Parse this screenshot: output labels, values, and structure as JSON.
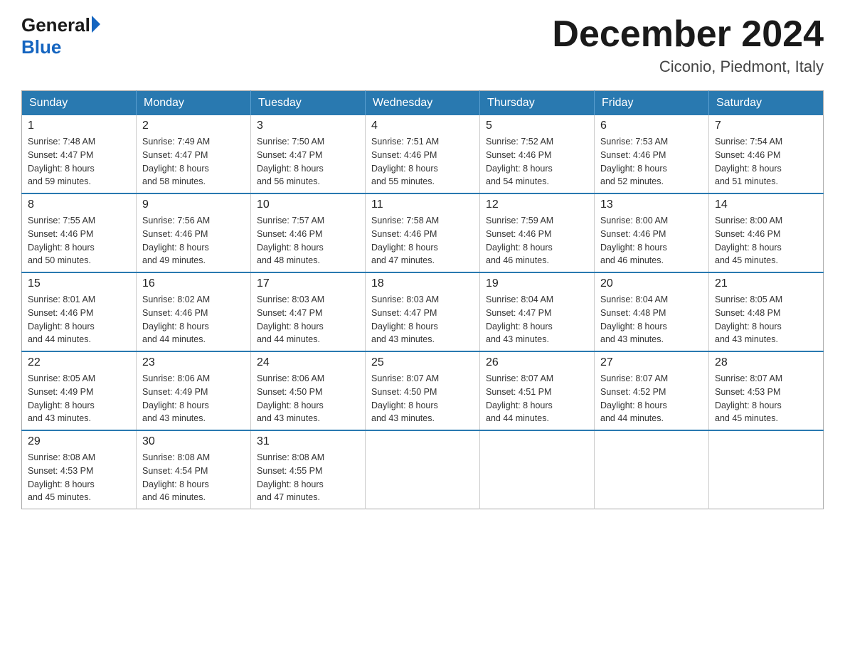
{
  "header": {
    "logo_general": "General",
    "logo_blue": "Blue",
    "month_title": "December 2024",
    "location": "Ciconio, Piedmont, Italy"
  },
  "days_of_week": [
    "Sunday",
    "Monday",
    "Tuesday",
    "Wednesday",
    "Thursday",
    "Friday",
    "Saturday"
  ],
  "weeks": [
    [
      {
        "day": "1",
        "sunrise": "7:48 AM",
        "sunset": "4:47 PM",
        "daylight": "8 hours and 59 minutes."
      },
      {
        "day": "2",
        "sunrise": "7:49 AM",
        "sunset": "4:47 PM",
        "daylight": "8 hours and 58 minutes."
      },
      {
        "day": "3",
        "sunrise": "7:50 AM",
        "sunset": "4:47 PM",
        "daylight": "8 hours and 56 minutes."
      },
      {
        "day": "4",
        "sunrise": "7:51 AM",
        "sunset": "4:46 PM",
        "daylight": "8 hours and 55 minutes."
      },
      {
        "day": "5",
        "sunrise": "7:52 AM",
        "sunset": "4:46 PM",
        "daylight": "8 hours and 54 minutes."
      },
      {
        "day": "6",
        "sunrise": "7:53 AM",
        "sunset": "4:46 PM",
        "daylight": "8 hours and 52 minutes."
      },
      {
        "day": "7",
        "sunrise": "7:54 AM",
        "sunset": "4:46 PM",
        "daylight": "8 hours and 51 minutes."
      }
    ],
    [
      {
        "day": "8",
        "sunrise": "7:55 AM",
        "sunset": "4:46 PM",
        "daylight": "8 hours and 50 minutes."
      },
      {
        "day": "9",
        "sunrise": "7:56 AM",
        "sunset": "4:46 PM",
        "daylight": "8 hours and 49 minutes."
      },
      {
        "day": "10",
        "sunrise": "7:57 AM",
        "sunset": "4:46 PM",
        "daylight": "8 hours and 48 minutes."
      },
      {
        "day": "11",
        "sunrise": "7:58 AM",
        "sunset": "4:46 PM",
        "daylight": "8 hours and 47 minutes."
      },
      {
        "day": "12",
        "sunrise": "7:59 AM",
        "sunset": "4:46 PM",
        "daylight": "8 hours and 46 minutes."
      },
      {
        "day": "13",
        "sunrise": "8:00 AM",
        "sunset": "4:46 PM",
        "daylight": "8 hours and 46 minutes."
      },
      {
        "day": "14",
        "sunrise": "8:00 AM",
        "sunset": "4:46 PM",
        "daylight": "8 hours and 45 minutes."
      }
    ],
    [
      {
        "day": "15",
        "sunrise": "8:01 AM",
        "sunset": "4:46 PM",
        "daylight": "8 hours and 44 minutes."
      },
      {
        "day": "16",
        "sunrise": "8:02 AM",
        "sunset": "4:46 PM",
        "daylight": "8 hours and 44 minutes."
      },
      {
        "day": "17",
        "sunrise": "8:03 AM",
        "sunset": "4:47 PM",
        "daylight": "8 hours and 44 minutes."
      },
      {
        "day": "18",
        "sunrise": "8:03 AM",
        "sunset": "4:47 PM",
        "daylight": "8 hours and 43 minutes."
      },
      {
        "day": "19",
        "sunrise": "8:04 AM",
        "sunset": "4:47 PM",
        "daylight": "8 hours and 43 minutes."
      },
      {
        "day": "20",
        "sunrise": "8:04 AM",
        "sunset": "4:48 PM",
        "daylight": "8 hours and 43 minutes."
      },
      {
        "day": "21",
        "sunrise": "8:05 AM",
        "sunset": "4:48 PM",
        "daylight": "8 hours and 43 minutes."
      }
    ],
    [
      {
        "day": "22",
        "sunrise": "8:05 AM",
        "sunset": "4:49 PM",
        "daylight": "8 hours and 43 minutes."
      },
      {
        "day": "23",
        "sunrise": "8:06 AM",
        "sunset": "4:49 PM",
        "daylight": "8 hours and 43 minutes."
      },
      {
        "day": "24",
        "sunrise": "8:06 AM",
        "sunset": "4:50 PM",
        "daylight": "8 hours and 43 minutes."
      },
      {
        "day": "25",
        "sunrise": "8:07 AM",
        "sunset": "4:50 PM",
        "daylight": "8 hours and 43 minutes."
      },
      {
        "day": "26",
        "sunrise": "8:07 AM",
        "sunset": "4:51 PM",
        "daylight": "8 hours and 44 minutes."
      },
      {
        "day": "27",
        "sunrise": "8:07 AM",
        "sunset": "4:52 PM",
        "daylight": "8 hours and 44 minutes."
      },
      {
        "day": "28",
        "sunrise": "8:07 AM",
        "sunset": "4:53 PM",
        "daylight": "8 hours and 45 minutes."
      }
    ],
    [
      {
        "day": "29",
        "sunrise": "8:08 AM",
        "sunset": "4:53 PM",
        "daylight": "8 hours and 45 minutes."
      },
      {
        "day": "30",
        "sunrise": "8:08 AM",
        "sunset": "4:54 PM",
        "daylight": "8 hours and 46 minutes."
      },
      {
        "day": "31",
        "sunrise": "8:08 AM",
        "sunset": "4:55 PM",
        "daylight": "8 hours and 47 minutes."
      },
      null,
      null,
      null,
      null
    ]
  ],
  "labels": {
    "sunrise": "Sunrise:",
    "sunset": "Sunset:",
    "daylight": "Daylight:"
  }
}
